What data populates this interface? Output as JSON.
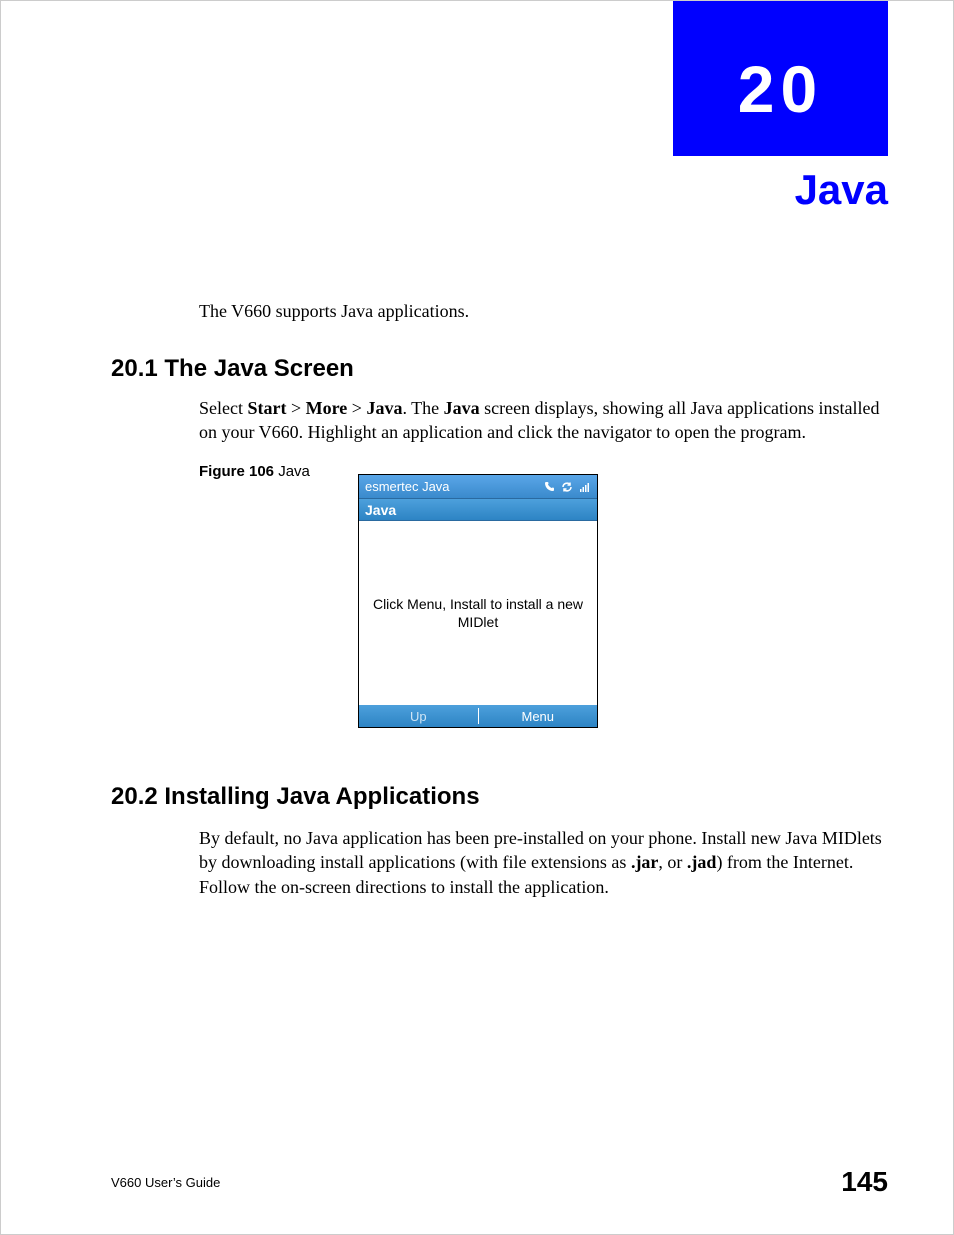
{
  "chapter": {
    "number": "20",
    "title": "Java"
  },
  "intro": "The V660 supports Java applications.",
  "section1": {
    "heading": "20.1  The Java Screen",
    "para_pre": "Select ",
    "bc1": "Start",
    "sep": " > ",
    "bc2": "More",
    "bc3": "Java",
    "para_mid": ". The ",
    "java_bold": "Java",
    "para_post": " screen displays, showing all Java applications installed on your V660. Highlight an application and click the navigator to open the program."
  },
  "figure": {
    "label": "Figure 106",
    "caption": "   Java"
  },
  "phone": {
    "status_title": "esmertec Java",
    "titlebar": "Java",
    "body": "Click Menu, Install to install a new MIDlet",
    "softkey_left": "Up",
    "softkey_right": "Menu"
  },
  "section2": {
    "heading": "20.2  Installing Java Applications",
    "para_pre": "By default, no Java application has been pre-installed on your phone. Install new Java MIDlets by downloading install applications (with file extensions as ",
    "ext1": ".jar",
    "mid": ", or ",
    "ext2": ".jad",
    "para_post": ") from the Internet. Follow the on-screen directions to install the application."
  },
  "footer": {
    "guide": "V660 User’s Guide",
    "page": "145"
  }
}
